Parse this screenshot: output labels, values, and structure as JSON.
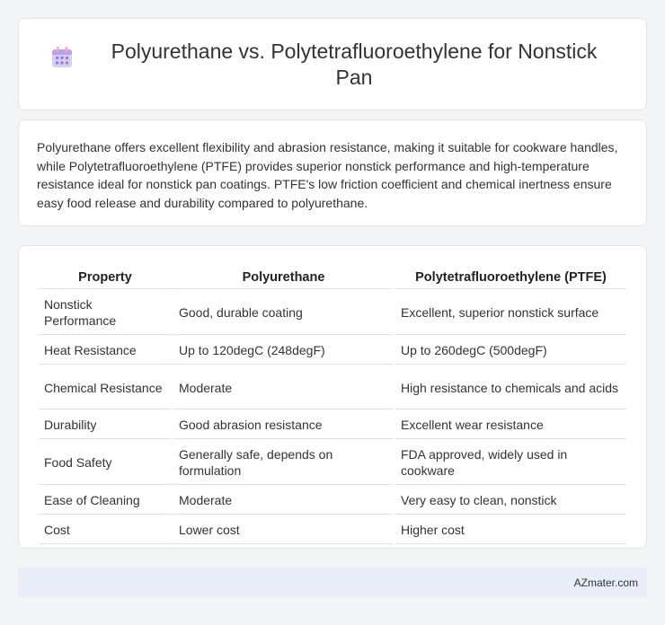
{
  "title": "Polyurethane vs. Polytetrafluoroethylene for Nonstick Pan",
  "title_icon": "calendar-icon",
  "summary": "Polyurethane offers excellent flexibility and abrasion resistance, making it suitable for cookware handles, while Polytetrafluoroethylene (PTFE) provides superior nonstick performance and high-temperature resistance ideal for nonstick pan coatings. PTFE's low friction coefficient and chemical inertness ensure easy food release and durability compared to polyurethane.",
  "table": {
    "headers": [
      "Property",
      "Polyurethane",
      "Polytetrafluoroethylene (PTFE)"
    ],
    "rows": [
      [
        "Nonstick Performance",
        "Good, durable coating",
        "Excellent, superior nonstick surface"
      ],
      [
        "Heat Resistance",
        "Up to 120degC (248degF)",
        "Up to 260degC (500degF)"
      ],
      [
        "Chemical Resistance",
        "Moderate",
        "High resistance to chemicals and acids"
      ],
      [
        "Durability",
        "Good abrasion resistance",
        "Excellent wear resistance"
      ],
      [
        "Food Safety",
        "Generally safe, depends on formulation",
        "FDA approved, widely used in cookware"
      ],
      [
        "Ease of Cleaning",
        "Moderate",
        "Very easy to clean, nonstick"
      ],
      [
        "Cost",
        "Lower cost",
        "Higher cost"
      ]
    ]
  },
  "footer": "AZmater.com",
  "colors": {
    "page_bg": "#f3f4f6",
    "footer_bg": "#e8edf7",
    "icon_purple": "#b9a3e8",
    "icon_pink": "#f3a3c8"
  }
}
